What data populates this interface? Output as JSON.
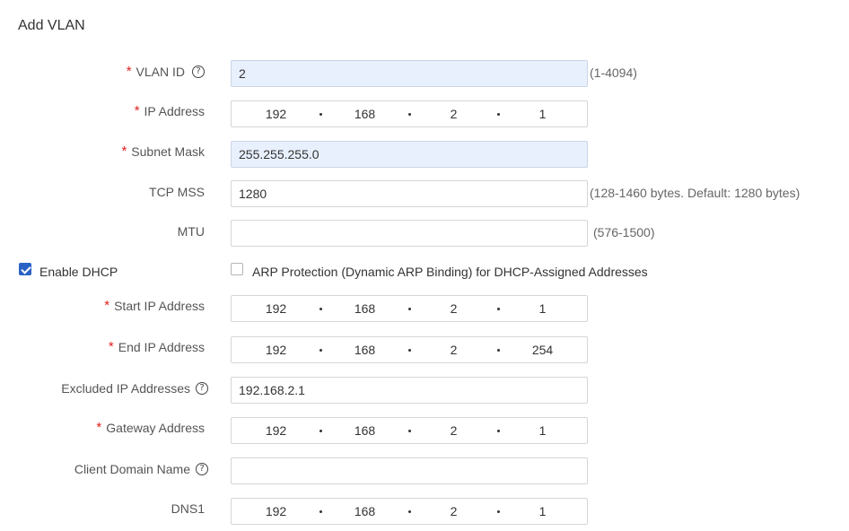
{
  "title": "Add VLAN",
  "fields": {
    "vlan_id": {
      "label": "VLAN ID",
      "value": "2",
      "hint": "(1-4094)"
    },
    "ip_address": {
      "label": "IP Address",
      "octets": [
        "192",
        "168",
        "2",
        "1"
      ]
    },
    "subnet_mask": {
      "label": "Subnet Mask",
      "value": "255.255.255.0"
    },
    "tcp_mss": {
      "label": "TCP MSS",
      "value": "1280",
      "hint": "(128-1460 bytes. Default: 1280 bytes)"
    },
    "mtu": {
      "label": "MTU",
      "value": "",
      "hint": "(576-1500)"
    }
  },
  "dhcp": {
    "enable_label": "Enable DHCP",
    "enabled": true,
    "arp_label": "ARP Protection (Dynamic ARP Binding) for DHCP-Assigned Addresses",
    "arp_enabled": false,
    "start_ip": {
      "label": "Start IP Address",
      "octets": [
        "192",
        "168",
        "2",
        "1"
      ]
    },
    "end_ip": {
      "label": "End IP Address",
      "octets": [
        "192",
        "168",
        "2",
        "254"
      ]
    },
    "excluded": {
      "label": "Excluded IP Addresses",
      "value": "192.168.2.1"
    },
    "gateway": {
      "label": "Gateway Address",
      "octets": [
        "192",
        "168",
        "2",
        "1"
      ]
    },
    "domain": {
      "label": "Client Domain Name",
      "value": ""
    },
    "dns1": {
      "label": "DNS1",
      "octets": [
        "192",
        "168",
        "2",
        "1"
      ]
    }
  },
  "required_mark": "*",
  "help_glyph": "?"
}
